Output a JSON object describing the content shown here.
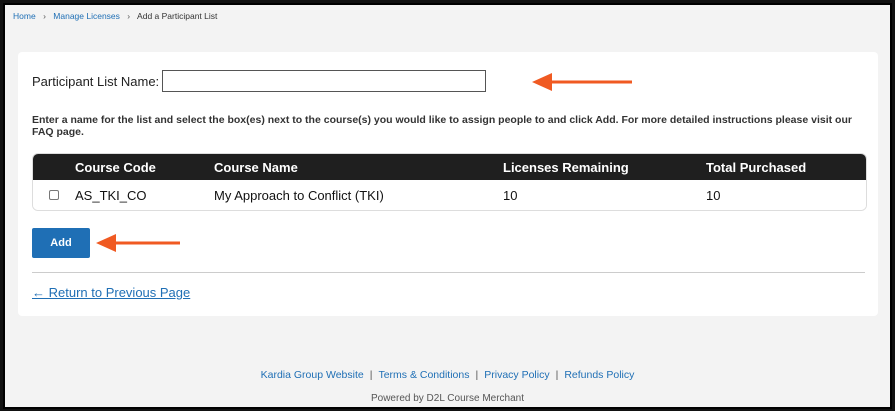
{
  "breadcrumb": {
    "items": [
      "Home",
      "Manage Licenses",
      "Add a Participant List"
    ],
    "separator": "›"
  },
  "form": {
    "name_label": "Participant List Name:",
    "name_value": "",
    "instructions": "Enter a name for the list and select the box(es) next to the course(s) you would like to assign people to and click Add. For more detailed instructions please visit our FAQ page."
  },
  "table": {
    "headers": [
      "Course Code",
      "Course Name",
      "Licenses Remaining",
      "Total Purchased"
    ],
    "rows": [
      {
        "code": "AS_TKI_CO",
        "name": "My Approach to Conflict (TKI)",
        "remaining": "10",
        "purchased": "10",
        "checked": false
      }
    ]
  },
  "actions": {
    "add_label": "Add",
    "return_label": "← Return to Previous Page"
  },
  "footer": {
    "links": [
      "Kardia Group Website",
      "Terms & Conditions",
      "Privacy Policy",
      "Refunds Policy"
    ],
    "separator": "|",
    "powered": "Powered by D2L Course Merchant"
  },
  "colors": {
    "accent": "#1f6fb5",
    "annotation_arrow": "#f05a22",
    "table_header": "#1f1f1f"
  }
}
